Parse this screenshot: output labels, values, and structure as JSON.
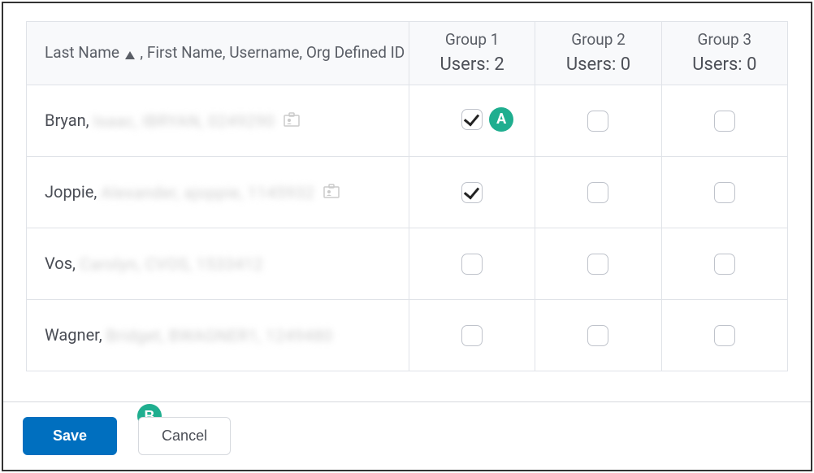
{
  "table": {
    "nameHeader": " , First Name, Username, Org Defined ID",
    "sortLabel": "Last Name",
    "groups": [
      {
        "name": "Group 1",
        "users": "Users: 2"
      },
      {
        "name": "Group 2",
        "users": "Users: 0"
      },
      {
        "name": "Group 3",
        "users": "Users: 0"
      }
    ],
    "rows": [
      {
        "lastName": "Bryan,",
        "rest": "Isaac, IBRYAN, 0249290",
        "checks": [
          true,
          false,
          false
        ]
      },
      {
        "lastName": "Joppie,",
        "rest": "Alexander, ajoppie, 1145932",
        "checks": [
          true,
          false,
          false
        ]
      },
      {
        "lastName": "Vos,",
        "rest": "Carolyn, CVOS, 1533412",
        "checks": [
          false,
          false,
          false
        ]
      },
      {
        "lastName": "Wagner,",
        "rest": "Bridget, BWAGNER1, 1249480",
        "checks": [
          false,
          false,
          false
        ]
      }
    ]
  },
  "annotations": {
    "a": "A",
    "b": "B"
  },
  "buttons": {
    "save": "Save",
    "cancel": "Cancel"
  }
}
